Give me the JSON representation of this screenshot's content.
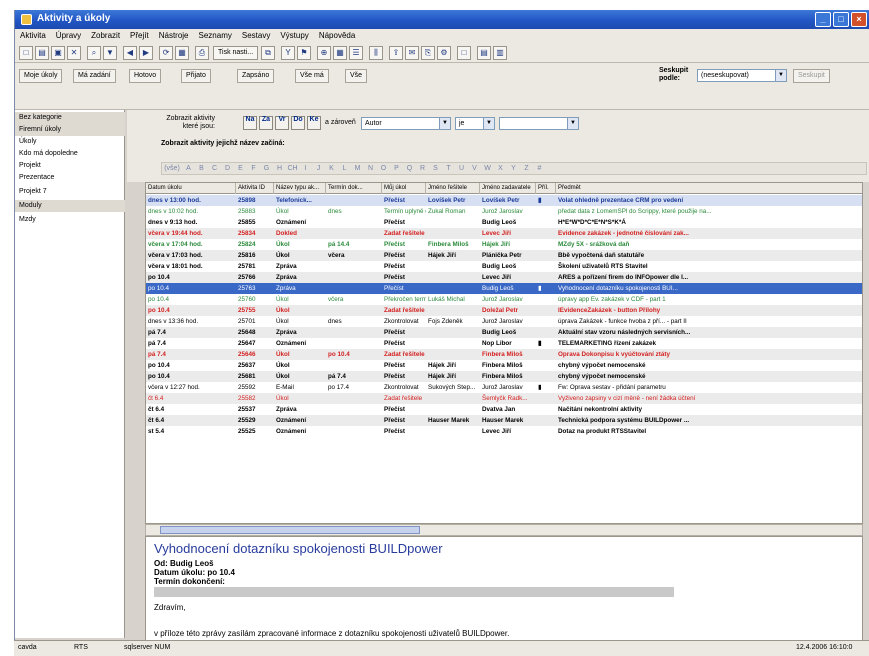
{
  "window": {
    "title": "Aktivity a úkoly"
  },
  "menu": [
    "Aktivita",
    "Úpravy",
    "Zobrazit",
    "Přejít",
    "Nástroje",
    "Seznamy",
    "Sestavy",
    "Výstupy",
    "Nápověda"
  ],
  "toolbar1": {
    "btn_label": "Tisk",
    "btn_label2": "Tisk nasti..."
  },
  "toolbar2": {
    "buttons": [
      "Moje úkoly",
      "Má zadání",
      "Hotovo",
      "Přijato",
      "Zapsáno",
      "Vše má",
      "Vše"
    ],
    "seskupit_label": "Seskupit podle:",
    "seskupit_value": "(nesesk­upovat)",
    "seskupit_disabled": "Seskupit"
  },
  "sidebar": {
    "items": [
      {
        "label": "Bez kategorie",
        "group": true
      },
      {
        "label": "Firemní úkoly",
        "group": true
      },
      {
        "label": "Úkoly",
        "group": false
      },
      {
        "label": "Kdo má dopoledne",
        "group": false
      },
      {
        "label": "Projekt",
        "group": false
      },
      {
        "label": "Prezentace",
        "group": false
      },
      {
        "label": "Projekt 7",
        "group": false
      },
      {
        "label": "Moduly",
        "group": true
      },
      {
        "label": "Mzdy",
        "group": false
      }
    ]
  },
  "filter": {
    "zobrazit_label": "Zobrazit aktivity které jsou:",
    "buttons": [
      "Na",
      "Za",
      "Vr",
      "Do",
      "Ke"
    ],
    "a_zaroven_label": "a zároveň",
    "field_value": "Autor",
    "operator_value": "je",
    "name_hint": "Zobrazit aktivity jejichž název začíná:",
    "alpha_first": "(vše)",
    "alphabet": [
      "A",
      "B",
      "C",
      "D",
      "E",
      "F",
      "G",
      "H",
      "CH",
      "I",
      "J",
      "K",
      "L",
      "M",
      "N",
      "O",
      "P",
      "Q",
      "R",
      "S",
      "T",
      "U",
      "V",
      "W",
      "X",
      "Y",
      "Z",
      "#"
    ]
  },
  "grid": {
    "columns": [
      "Datum úkolu",
      "Aktivita ID",
      "Název typu ak...",
      "Termín dok...",
      "Můj úkol",
      "Jméno řešitele",
      "Jméno zadavatele",
      "Příl.",
      "Předmět"
    ],
    "rows": [
      {
        "cells": [
          "dnes v 13:00 hod.",
          "25898",
          "Telefonick...",
          "",
          "Přečíst",
          "Lovíšek Petr",
          "Lovíšek Petr",
          "▮",
          "Volat ohledně prezentace CRM pro vedení"
        ],
        "color": "#1a3a9a",
        "bg": "#d7e0f3",
        "bold": true
      },
      {
        "cells": [
          "dnes v 10:02 hod.",
          "25883",
          "Úkol",
          "dnes",
          "Termín uply­ně d...",
          "Zukal Roman",
          "Jurož Jaroslav",
          "",
          "předat data z LomemSPl do Scrippy, které použije na..."
        ],
        "color": "#2a8a3a",
        "bg": "#ffffff",
        "bold": false
      },
      {
        "cells": [
          "dnes v 9:13 hod.",
          "25855",
          "Oznámení",
          "",
          "Přečíst",
          "",
          "Budig Leoš",
          "",
          "H*E*W*D*C*E*N*S*K*Á"
        ],
        "color": "#000000",
        "bg": "#ffffff",
        "bold": true
      },
      {
        "cells": [
          "včera v 19:44 hod.",
          "25834",
          "Dokled",
          "",
          "Zadat řešitele",
          "",
          "Levec Jiří",
          "",
          "Evidence zakázek - jednotné číslování zak..."
        ],
        "color": "#d42020",
        "bg": "#ebebeb",
        "bold": true
      },
      {
        "cells": [
          "včera v 17:04 hod.",
          "25824",
          "Úkol",
          "pá 14.4",
          "Přečíst",
          "Finbera Miloš",
          "Hájek Jiří",
          "",
          "MZdy 5X - srážková daň"
        ],
        "color": "#2a8a3a",
        "bg": "#ffffff",
        "bold": true
      },
      {
        "cells": [
          "včera v 17:03 hod.",
          "25816",
          "Úkol",
          "včera",
          "Přečíst",
          "Hájek Jiří",
          "Plánička Petr",
          "",
          "Bbě vypočtená daň statutáře"
        ],
        "color": "#000000",
        "bg": "#ebebeb",
        "bold": true
      },
      {
        "cells": [
          "včera v 18:01 hod.",
          "25781",
          "Zpráva",
          "",
          "Přečíst",
          "",
          "Budig Leoš",
          "",
          "Školení uživatelů RTS Stavitel"
        ],
        "color": "#000000",
        "bg": "#ffffff",
        "bold": true
      },
      {
        "cells": [
          "po 10.4",
          "25766",
          "Zpráva",
          "",
          "Přečíst",
          "",
          "Levec Jiří",
          "",
          "ARES a pořízení firem do INFOpower dle I..."
        ],
        "color": "#000000",
        "bg": "#ebebeb",
        "bold": true
      },
      {
        "cells": [
          "po 10.4",
          "25763",
          "Zpráva",
          "",
          "Přečíst",
          "",
          "Budig Leoš",
          "▮",
          "Vyhodnocení dotazníku spokojenosti BUI..."
        ],
        "color": "#ffffff",
        "bg": "#3a68c6",
        "bold": false
      },
      {
        "cells": [
          "po 10.4",
          "25760",
          "Úkol",
          "včera",
          "Překročen termín",
          "Lukáš Michal",
          "Jurož Jaroslav",
          "",
          "úpravy app Ev. zakázek v CDF - part 1"
        ],
        "color": "#2a8a3a",
        "bg": "#ffffff",
        "bold": false
      },
      {
        "cells": [
          "po 10.4",
          "25755",
          "Úkol",
          "",
          "Zadat řešitele",
          "",
          "Doležal Petr",
          "",
          "IEvidenceZakázek - button Přílohy"
        ],
        "color": "#d42020",
        "bg": "#ebebeb",
        "bold": true
      },
      {
        "cells": [
          "dnes v 13:36 hod.",
          "25701",
          "Úkol",
          "dnes",
          "Zkontrolovat",
          "Fojs Zdeněk",
          "Jurož Jaroslav",
          "",
          "úprava Zakázek - funkce hvoba z pří... - part II"
        ],
        "color": "#000000",
        "bg": "#ffffff",
        "bold": false
      },
      {
        "cells": [
          "pá 7.4",
          "25648",
          "Zpráva",
          "",
          "Přečíst",
          "",
          "Budig Leoš",
          "",
          "Aktuální stav vzoru následných servisních..."
        ],
        "color": "#000000",
        "bg": "#ebebeb",
        "bold": true
      },
      {
        "cells": [
          "pá 7.4",
          "25647",
          "Oznámení",
          "",
          "Přečíst",
          "",
          "Nop Libor",
          "▮",
          "TELEMARKETING řízení zakázek"
        ],
        "color": "#000000",
        "bg": "#ffffff",
        "bold": true
      },
      {
        "cells": [
          "pá 7.4",
          "25646",
          "Úkol",
          "po 10.4",
          "Zadat řešitele",
          "",
          "Finbera Miloš",
          "",
          "Oprava Dokonpisu k vyúčtování ztáty"
        ],
        "color": "#d42020",
        "bg": "#ebebeb",
        "bold": true
      },
      {
        "cells": [
          "po 10.4",
          "25637",
          "Úkol",
          "",
          "Přečíst",
          "Hájek Jiří",
          "Finbera Miloš",
          "",
          "chybný výpočet nemocenské"
        ],
        "color": "#000000",
        "bg": "#ffffff",
        "bold": true
      },
      {
        "cells": [
          "po 10.4",
          "25681",
          "Úkol",
          "pá 7.4",
          "Přečíst",
          "Hájek Jiří",
          "Finbera Miloš",
          "",
          "chybný výpočet nemocenské"
        ],
        "color": "#000000",
        "bg": "#ebebeb",
        "bold": true
      },
      {
        "cells": [
          "včera v 12:27 hod.",
          "25592",
          "E-Mail",
          "po 17.4",
          "Zkontrolovat",
          "Sukových Step...",
          "Jurož Jaroslav",
          "▮",
          "Fw: Oprava sestav - přidání parametru"
        ],
        "color": "#000000",
        "bg": "#ffffff",
        "bold": false
      },
      {
        "cells": [
          "čt 6.4",
          "25582",
          "Úkol",
          "",
          "Zadat řešitele",
          "",
          "Šemlyčk Radk...",
          "",
          "Vyživeno zapsiny v cizí měně - není žádka účtení"
        ],
        "color": "#d42020",
        "bg": "#ebebeb",
        "bold": false
      },
      {
        "cells": [
          "čt 6.4",
          "25537",
          "Zpráva",
          "",
          "Přečíst",
          "",
          "Dvatva Jan",
          "",
          "Načítání nekontrolní aktivity"
        ],
        "color": "#000000",
        "bg": "#ffffff",
        "bold": true
      },
      {
        "cells": [
          "čt 6.4",
          "25529",
          "Oznámení",
          "",
          "Přečíst",
          "Hauser Marek",
          "Hauser Marek",
          "",
          "Technická podpora systému BUILDpower ..."
        ],
        "color": "#000000",
        "bg": "#ebebeb",
        "bold": true
      },
      {
        "cells": [
          "st 5.4",
          "25525",
          "Oznámení",
          "",
          "Přečíst",
          "",
          "Levec Jiří",
          "",
          "Dotaz na produkt RTSStavitel"
        ],
        "color": "#000000",
        "bg": "#ffffff",
        "bold": true
      }
    ]
  },
  "preview": {
    "title": "Vyhodnocení dotazníku spokojenosti BUILDpower",
    "od": "Od: Budig Leoš",
    "datum": "Datum úkolu: po 10.4",
    "termin": "Termín dokončení:",
    "greeting": "Zdravím,",
    "body": "v příloze této zprávy zasílám zpracované informace z dotazníku spokojenosti uživatelů BUILDpower."
  },
  "status": {
    "user": "cavda",
    "module": "RTS",
    "server": "sqlserver NUM",
    "datetime": "12.4.2006 16:10:0"
  }
}
